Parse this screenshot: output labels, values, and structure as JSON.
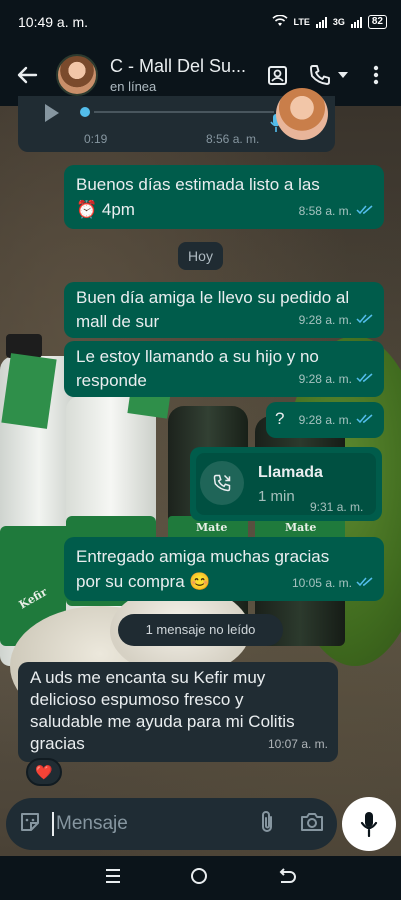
{
  "status_bar": {
    "time": "10:49 a. m.",
    "network_labels": [
      "LTE",
      "3G"
    ],
    "battery": "82"
  },
  "header": {
    "contact_name": "C - Mall Del Su...",
    "contact_status": "en línea",
    "icons": [
      "back-arrow-icon",
      "avatar",
      "contact-card-icon",
      "phone-icon",
      "dropdown-icon",
      "more-options-icon"
    ]
  },
  "messages": {
    "audio": {
      "duration": "0:19",
      "time": "8:56 a. m."
    },
    "m1": {
      "text": "Buenos días estimada listo a las ⏰ 4pm",
      "time": "8:58 a. m."
    },
    "day_divider": "Hoy",
    "m2": {
      "text": "Buen día amiga le llevo su pedido al mall de sur",
      "time": "9:28 a. m."
    },
    "m3": {
      "text": "Le estoy llamando a su hijo y no responde",
      "time": "9:28 a. m."
    },
    "m4": {
      "text": "?",
      "time": "9:28 a. m."
    },
    "call": {
      "title": "Llamada",
      "duration": "1 min",
      "time": "9:31 a. m."
    },
    "m5": {
      "text": "Entregado amiga muchas gracias por su compra 😊",
      "time": "10:05 a. m."
    },
    "unread_divider": "1 mensaje no leído",
    "m6": {
      "text": "A uds me encanta su Kefir muy delicioso espumoso fresco y saludable me ayuda para mi Colitis gracias",
      "time": "10:07 a. m.",
      "reaction": "❤️"
    }
  },
  "wallpaper_text": {
    "brand": "Kefir",
    "bottle_label": "Mate"
  },
  "input": {
    "placeholder": "Mensaje"
  },
  "colors": {
    "outgoing": "#005c4b",
    "incoming": "#202c33",
    "read_ticks": "#53bdeb"
  }
}
